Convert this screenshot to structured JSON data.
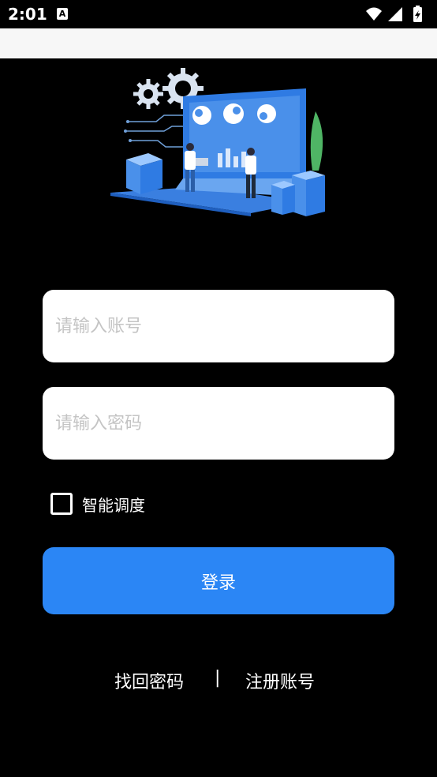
{
  "status_bar": {
    "time": "2:01",
    "notif_icon": "A"
  },
  "form": {
    "account_placeholder": "请输入账号",
    "password_placeholder": "请输入密码",
    "remember_label": "智能调度",
    "login_label": "登录"
  },
  "footer": {
    "forgot_label": "找回密码",
    "divider": "|",
    "register_label": "注册账号"
  },
  "colors": {
    "accent": "#2b86f5",
    "background": "#000000",
    "app_bar": "#f7f7f7"
  }
}
